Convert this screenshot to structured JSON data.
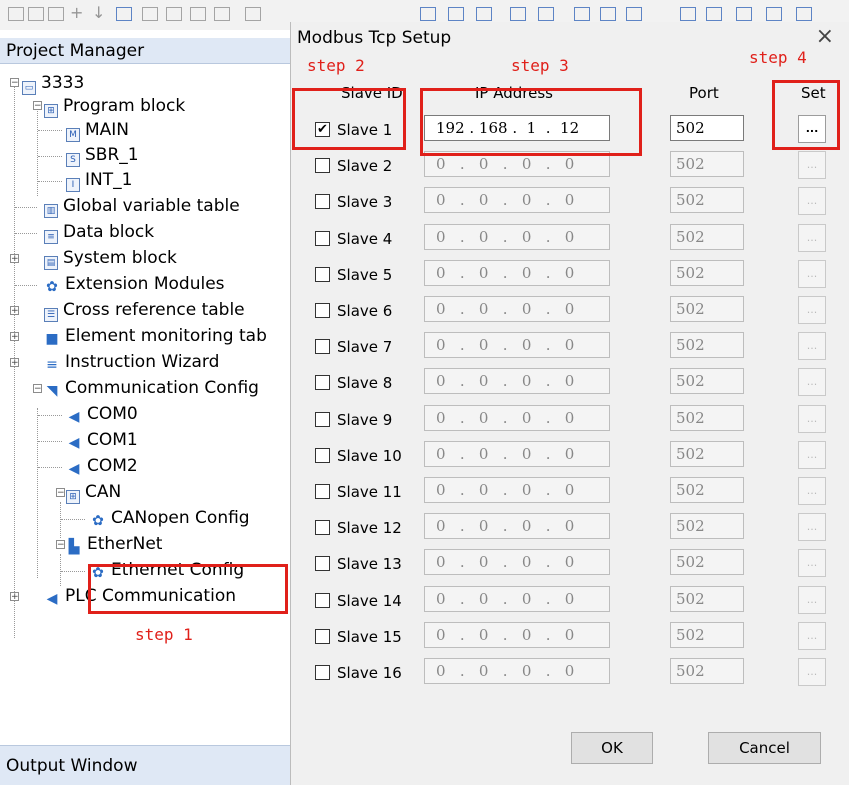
{
  "project_manager": {
    "title": "Project Manager",
    "tree": [
      {
        "id": "root",
        "label": "3333",
        "icon": "computer-icon",
        "depth": 0
      },
      {
        "id": "program-block",
        "label": "Program block",
        "icon": "program-block-icon",
        "depth": 1
      },
      {
        "id": "main",
        "label": "MAIN",
        "icon": "main-icon",
        "depth": 2
      },
      {
        "id": "sbr",
        "label": "SBR_1",
        "icon": "subroutine-icon",
        "depth": 2
      },
      {
        "id": "int",
        "label": "INT_1",
        "icon": "interrupt-icon",
        "depth": 2
      },
      {
        "id": "global",
        "label": "Global variable table",
        "icon": "table-icon",
        "depth": 1
      },
      {
        "id": "data",
        "label": "Data block",
        "icon": "data-block-icon",
        "depth": 1
      },
      {
        "id": "system",
        "label": "System block",
        "icon": "system-block-icon",
        "depth": 1
      },
      {
        "id": "ext",
        "label": "Extension Modules",
        "icon": "gear-icon",
        "depth": 1
      },
      {
        "id": "xref",
        "label": "Cross reference table",
        "icon": "list-icon",
        "depth": 1
      },
      {
        "id": "elem",
        "label": "Element monitoring tab",
        "icon": "monitor-icon",
        "depth": 1
      },
      {
        "id": "wizard",
        "label": "Instruction Wizard",
        "icon": "list-icon",
        "depth": 1
      },
      {
        "id": "comm",
        "label": "Communication Config",
        "icon": "comm-icon",
        "depth": 1
      },
      {
        "id": "com0",
        "label": "COM0",
        "icon": "port-icon",
        "depth": 2
      },
      {
        "id": "com1",
        "label": "COM1",
        "icon": "port-icon",
        "depth": 2
      },
      {
        "id": "com2",
        "label": "COM2",
        "icon": "port-icon",
        "depth": 2
      },
      {
        "id": "can",
        "label": "CAN",
        "icon": "can-icon",
        "depth": 2
      },
      {
        "id": "canopen",
        "label": "CANopen Config",
        "icon": "gear-icon",
        "depth": 3
      },
      {
        "id": "ethernet",
        "label": "EtherNet",
        "icon": "network-icon",
        "depth": 2
      },
      {
        "id": "ethcfg",
        "label": "Ethernet Config",
        "icon": "gear-icon",
        "depth": 3
      },
      {
        "id": "plc",
        "label": "PLC Communication",
        "icon": "port-icon",
        "depth": 1
      }
    ],
    "output_window": "Output Window"
  },
  "annotations": {
    "step1": "step 1",
    "step2": "step 2",
    "step3": "step 3",
    "step4": "step 4"
  },
  "dialog": {
    "title": "Modbus Tcp Setup",
    "close": "×",
    "headers": {
      "slave_id": "Slave ID",
      "ip": "IP Address",
      "port": "Port",
      "set": "Set"
    },
    "slaves": [
      {
        "name": "Slave 1",
        "checked": true,
        "ip": "192 . 168 .  1  .  12",
        "port": "502"
      },
      {
        "name": "Slave 2",
        "checked": false,
        "ip": "0   .   0   .   0   .   0",
        "port": "502"
      },
      {
        "name": "Slave 3",
        "checked": false,
        "ip": "0   .   0   .   0   .   0",
        "port": "502"
      },
      {
        "name": "Slave 4",
        "checked": false,
        "ip": "0   .   0   .   0   .   0",
        "port": "502"
      },
      {
        "name": "Slave 5",
        "checked": false,
        "ip": "0   .   0   .   0   .   0",
        "port": "502"
      },
      {
        "name": "Slave 6",
        "checked": false,
        "ip": "0   .   0   .   0   .   0",
        "port": "502"
      },
      {
        "name": "Slave 7",
        "checked": false,
        "ip": "0   .   0   .   0   .   0",
        "port": "502"
      },
      {
        "name": "Slave 8",
        "checked": false,
        "ip": "0   .   0   .   0   .   0",
        "port": "502"
      },
      {
        "name": "Slave 9",
        "checked": false,
        "ip": "0   .   0   .   0   .   0",
        "port": "502"
      },
      {
        "name": "Slave 10",
        "checked": false,
        "ip": "0   .   0   .   0   .   0",
        "port": "502"
      },
      {
        "name": "Slave 11",
        "checked": false,
        "ip": "0   .   0   .   0   .   0",
        "port": "502"
      },
      {
        "name": "Slave 12",
        "checked": false,
        "ip": "0   .   0   .   0   .   0",
        "port": "502"
      },
      {
        "name": "Slave 13",
        "checked": false,
        "ip": "0   .   0   .   0   .   0",
        "port": "502"
      },
      {
        "name": "Slave 14",
        "checked": false,
        "ip": "0   .   0   .   0   .   0",
        "port": "502"
      },
      {
        "name": "Slave 15",
        "checked": false,
        "ip": "0   .   0   .   0   .   0",
        "port": "502"
      },
      {
        "name": "Slave 16",
        "checked": false,
        "ip": "0   .   0   .   0   .   0",
        "port": "502"
      }
    ],
    "set_label": "...",
    "ok": "OK",
    "cancel": "Cancel",
    "check_mark": "✔"
  },
  "colors": {
    "annotation_red": "#e0201a",
    "header_blue": "#dfe8f5"
  }
}
